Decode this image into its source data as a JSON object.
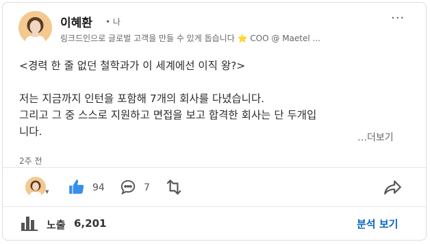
{
  "post": {
    "author": {
      "name": "이혜환",
      "degree": "• 나",
      "headline": "링크드인으로 글로벌 고객을 만들 수 있게 돕습니다 ⭐ COO @ Maetel ..."
    },
    "content_lines": [
      "<경력 한 줄 없던 철학과가 이 세계에선 이직 왕?>",
      "",
      "저는 지금까지 인턴을 포함해 7개의 회사를 다녔습니다.",
      "그리고 그 중 스스로 지원하고 면접을 보고 합격한 회사는 단 두개입",
      "니다."
    ],
    "see_more": "…더보기",
    "time_ago": "2주 전",
    "more_menu": "···"
  },
  "actions": {
    "likes": "94",
    "comments": "7"
  },
  "stats": {
    "impressions_label": "노출",
    "impressions_count": "6,201",
    "analytics_button": "분석 보기"
  },
  "colors": {
    "accent": "#0a66c2",
    "like_blue": "#378fe9",
    "text_secondary": "#666666"
  },
  "icons": [
    "more-icon",
    "like-icon",
    "comment-icon",
    "repost-icon",
    "share-icon",
    "bar-chart-icon",
    "star-icon"
  ]
}
